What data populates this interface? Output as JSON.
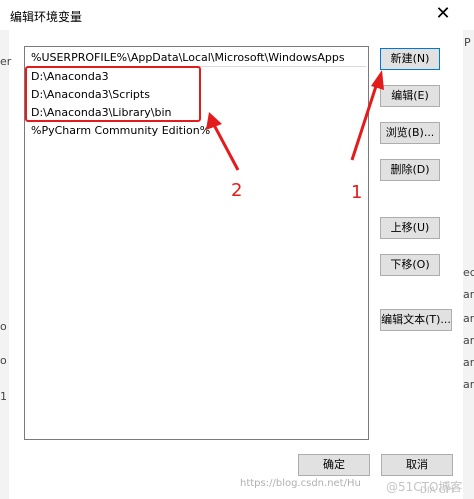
{
  "window": {
    "title": "编辑环境变量",
    "close_glyph": "✕"
  },
  "list": {
    "items": [
      "%USERPROFILE%\\AppData\\Local\\Microsoft\\WindowsApps",
      "D:\\Anaconda3",
      "D:\\Anaconda3\\Scripts",
      "D:\\Anaconda3\\Library\\bin",
      "%PyCharm Community Edition%"
    ]
  },
  "buttons": {
    "new": "新建(N)",
    "edit": "编辑(E)",
    "browse": "浏览(B)...",
    "delete": "删除(D)",
    "move_up": "上移(U)",
    "move_down": "下移(O)",
    "edit_text": "编辑文本(T)...",
    "ok": "确定",
    "cancel": "取消"
  },
  "annotations": {
    "label_1": "1",
    "label_2": "2",
    "color": "#e41b1b"
  },
  "background_fragments": {
    "right_top": "P",
    "right_a": "ec",
    "right_b": "ar",
    "right_c": "ar",
    "right_d": "ar",
    "right_e": "ar",
    "right_f": "ar",
    "left_a": "er",
    "left_b": "o",
    "left_c": "o",
    "left_d": "1"
  },
  "watermark": {
    "text": "https://blog.csdn.net/Hu",
    "text2": "@51CTO博客",
    "text3": "DIA GPI"
  }
}
